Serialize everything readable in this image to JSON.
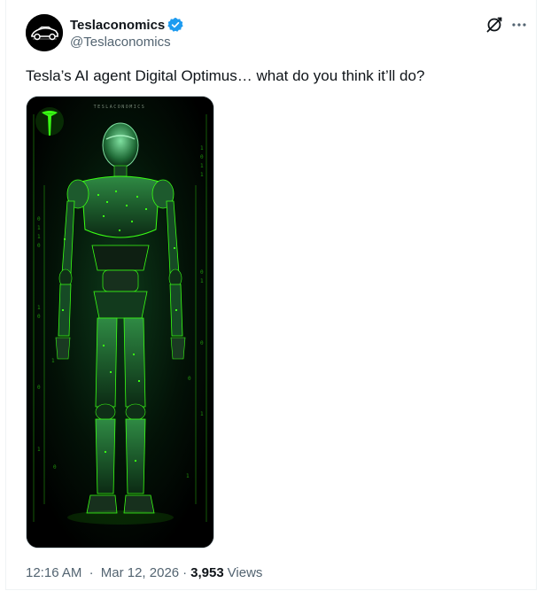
{
  "author": {
    "display_name": "Teslaconomics",
    "handle": "@Teslaconomics",
    "verified_color": "#1d9bf0"
  },
  "header_actions": {
    "grok_icon": "grok-icon",
    "more_icon": "more-icon",
    "more_glyph": "···"
  },
  "tweet": {
    "text": "Tesla’s AI agent Digital Optimus… what do you think it’ll do?"
  },
  "media": {
    "watermark": "TESLACONOMICS",
    "accent_color": "#39ff14"
  },
  "meta": {
    "time": "12:16 AM",
    "separator": "·",
    "date": "Mar 12, 2026",
    "views_count": "3,953",
    "views_label": "Views"
  }
}
